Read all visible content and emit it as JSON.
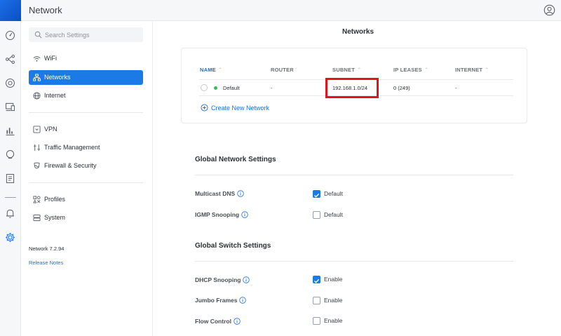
{
  "app": {
    "title": "Network"
  },
  "search": {
    "placeholder": "Search Settings"
  },
  "sidebar": {
    "items": [
      {
        "label": "WiFi",
        "icon": "wifi-icon"
      },
      {
        "label": "Networks",
        "icon": "networks-icon",
        "active": true
      },
      {
        "label": "Internet",
        "icon": "globe-icon"
      },
      {
        "label": "VPN",
        "icon": "vpn-icon"
      },
      {
        "label": "Traffic Management",
        "icon": "traffic-icon"
      },
      {
        "label": "Firewall & Security",
        "icon": "shield-icon"
      },
      {
        "label": "Profiles",
        "icon": "profiles-icon"
      },
      {
        "label": "System",
        "icon": "system-icon"
      }
    ],
    "version": "Network 7.2.94",
    "release_notes": "Release Notes"
  },
  "main": {
    "title": "Networks",
    "table": {
      "headers": [
        "NAME",
        "ROUTER",
        "SUBNET",
        "IP LEASES",
        "INTERNET"
      ],
      "rows": [
        {
          "name": "Default",
          "router": "-",
          "subnet": "192.168.1.0/24",
          "ip_leases": "0 (249)",
          "internet": "-"
        }
      ]
    },
    "create_link": "Create New Network",
    "global_network": {
      "title": "Global Network Settings",
      "settings": [
        {
          "label": "Multicast DNS",
          "value_label": "Default",
          "checked": true
        },
        {
          "label": "IGMP Snooping",
          "value_label": "Default",
          "checked": false
        }
      ]
    },
    "global_switch": {
      "title": "Global Switch Settings",
      "settings": [
        {
          "label": "DHCP Snooping",
          "value_label": "Enable",
          "checked": true
        },
        {
          "label": "Jumbo Frames",
          "value_label": "Enable",
          "checked": false
        },
        {
          "label": "Flow Control",
          "value_label": "Enable",
          "checked": false
        }
      ]
    }
  },
  "colors": {
    "accent": "#1b7ae6",
    "highlight": "#e0141b",
    "online": "#2fbf5b"
  }
}
